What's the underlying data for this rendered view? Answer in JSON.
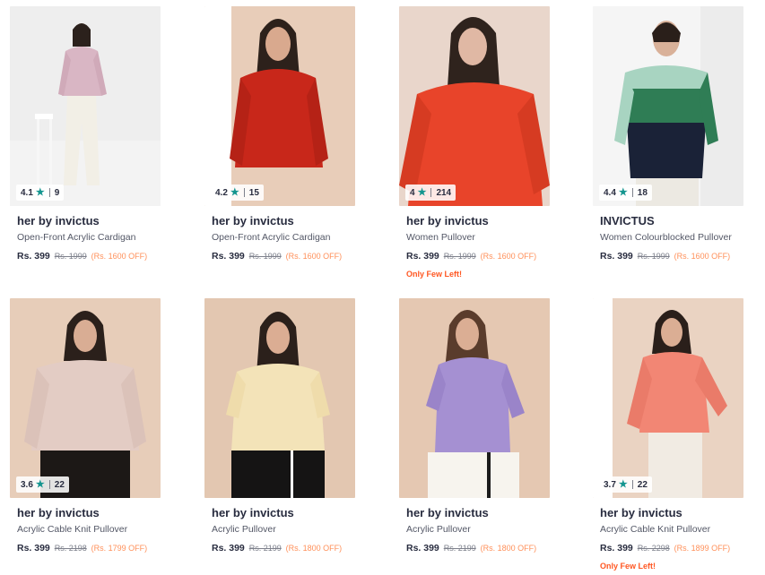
{
  "products": [
    {
      "rating": "4.1",
      "count": "9",
      "brand": "her by invictus",
      "name": "Open-Front Acrylic Cardigan",
      "price": "Rs. 399",
      "mrp": "Rs. 1999",
      "discount": "(Rs. 1600 OFF)",
      "note": ""
    },
    {
      "rating": "4.2",
      "count": "15",
      "brand": "her by invictus",
      "name": "Open-Front Acrylic Cardigan",
      "price": "Rs. 399",
      "mrp": "Rs. 1999",
      "discount": "(Rs. 1600 OFF)",
      "note": ""
    },
    {
      "rating": "4",
      "count": "214",
      "brand": "her by invictus",
      "name": "Women Pullover",
      "price": "Rs. 399",
      "mrp": "Rs. 1999",
      "discount": "(Rs. 1600 OFF)",
      "note": "Only Few Left!"
    },
    {
      "rating": "4.4",
      "count": "18",
      "brand": "INVICTUS",
      "name": "Women Colourblocked Pullover",
      "price": "Rs. 399",
      "mrp": "Rs. 1999",
      "discount": "(Rs. 1600 OFF)",
      "note": ""
    },
    {
      "rating": "3.6",
      "count": "22",
      "brand": "her by invictus",
      "name": "Acrylic Cable Knit Pullover",
      "price": "Rs. 399",
      "mrp": "Rs. 2198",
      "discount": "(Rs. 1799 OFF)",
      "note": ""
    },
    {
      "rating": "",
      "count": "",
      "brand": "her by invictus",
      "name": "Acrylic Pullover",
      "price": "Rs. 399",
      "mrp": "Rs. 2199",
      "discount": "(Rs. 1800 OFF)",
      "note": ""
    },
    {
      "rating": "",
      "count": "",
      "brand": "her by invictus",
      "name": "Acrylic Pullover",
      "price": "Rs. 399",
      "mrp": "Rs. 2199",
      "discount": "(Rs. 1800 OFF)",
      "note": ""
    },
    {
      "rating": "3.7",
      "count": "22",
      "brand": "her by invictus",
      "name": "Acrylic Cable Knit Pullover",
      "price": "Rs. 399",
      "mrp": "Rs. 2298",
      "discount": "(Rs. 1899 OFF)",
      "note": "Only Few Left!"
    }
  ],
  "icons": {
    "rating_star": "star-icon"
  },
  "colors": {
    "rating_star": "#14958f",
    "discount": "#ff905a",
    "few_left": "#ff5722",
    "brand": "#282c3f"
  }
}
